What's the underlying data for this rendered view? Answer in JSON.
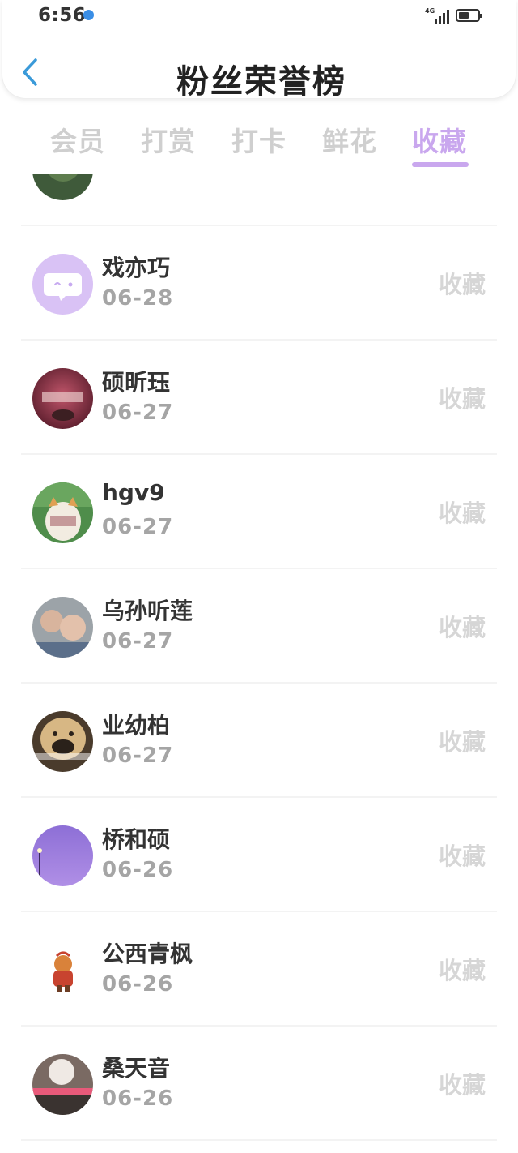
{
  "status_bar": {
    "time": "6:56",
    "network": "4G"
  },
  "header": {
    "title": "粉丝荣誉榜",
    "back_icon": "chevron-left-icon"
  },
  "tabs": [
    {
      "label": "会员",
      "active": false
    },
    {
      "label": "打赏",
      "active": false
    },
    {
      "label": "打卡",
      "active": false
    },
    {
      "label": "鲜花",
      "active": false
    },
    {
      "label": "收藏",
      "active": true
    }
  ],
  "colors": {
    "accent": "#c9a7ee",
    "back_icon": "#3a9ad9",
    "inactive_tab": "#cfcfcf"
  },
  "fans": [
    {
      "name": "",
      "date": "",
      "action": "",
      "avatar": "green-partial"
    },
    {
      "name": "戏亦巧",
      "date": "06-28",
      "action": "收藏",
      "avatar": "default-chat-bubble"
    },
    {
      "name": "硕昕珏",
      "date": "06-27",
      "action": "收藏",
      "avatar": "photo-red"
    },
    {
      "name": "hgv9",
      "date": "06-27",
      "action": "收藏",
      "avatar": "photo-cat"
    },
    {
      "name": "乌孙听莲",
      "date": "06-27",
      "action": "收藏",
      "avatar": "photo-children"
    },
    {
      "name": "业幼柏",
      "date": "06-27",
      "action": "收藏",
      "avatar": "photo-dog"
    },
    {
      "name": "桥和硕",
      "date": "06-26",
      "action": "收藏",
      "avatar": "photo-purple-sky"
    },
    {
      "name": "公西青枫",
      "date": "06-26",
      "action": "收藏",
      "avatar": "photo-cartoon"
    },
    {
      "name": "桑天音",
      "date": "06-26",
      "action": "收藏",
      "avatar": "photo-portrait"
    }
  ]
}
